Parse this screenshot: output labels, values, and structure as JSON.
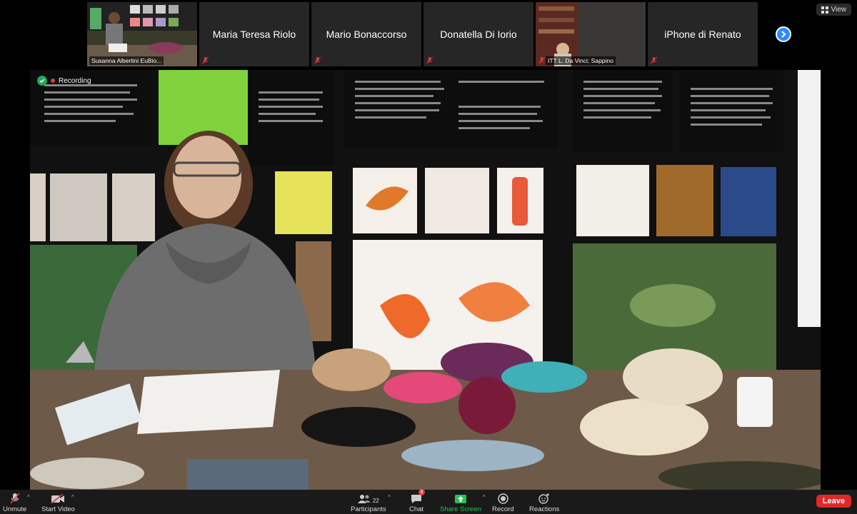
{
  "strip": {
    "tiles": [
      {
        "label": "Susanna Albertini  EuBio..."
      },
      {
        "name": "Maria Teresa Riolo"
      },
      {
        "name": "Mario Bonaccorso"
      },
      {
        "name": "Donatella Di Iorio"
      },
      {
        "label": "ITT L. Da Vinci; Sappino"
      },
      {
        "name": "iPhone di Renato"
      }
    ]
  },
  "view_button": {
    "label": "View"
  },
  "main": {
    "recording_label": "Recording"
  },
  "toolbar": {
    "unmute": "Unmute",
    "start_video": "Start Video",
    "participants": "Participants",
    "participants_count": "22",
    "chat": "Chat",
    "chat_badge": "6",
    "share_screen": "Share Screen",
    "record": "Record",
    "reactions": "Reactions",
    "leave": "Leave"
  },
  "colors": {
    "accent": "#2d8cff",
    "share_green": "#23c552",
    "leave_red": "#e02828",
    "active_outline": "#b6c43a"
  }
}
